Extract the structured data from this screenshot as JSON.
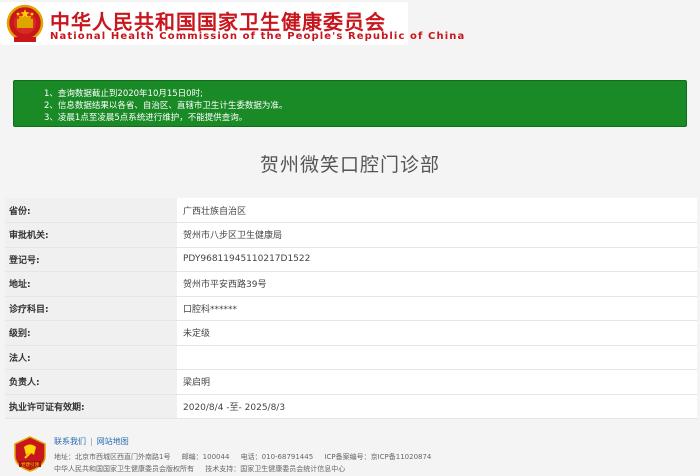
{
  "header": {
    "title_cn": "中华人民共和国国家卫生健康委员会",
    "title_en": "National Health Commission of the People's Republic of China",
    "brand_color": "#c8161d"
  },
  "notice": {
    "background": "#198a26",
    "lines": [
      "1、查询数据截止到2020年10月15日0时;",
      "2、信息数据结果以各省、自治区、直辖市卫生计生委数据为准。",
      "3、凌晨1点至凌晨5点系统进行维护，不能提供查询。"
    ]
  },
  "page_title": "贺州微笑口腔门诊部",
  "info_rows": [
    {
      "label": "省份:",
      "value": "广西壮族自治区"
    },
    {
      "label": "审批机关:",
      "value": "贺州市八步区卫生健康局"
    },
    {
      "label": "登记号:",
      "value": "PDY96811945110217D1522"
    },
    {
      "label": "地址:",
      "value": "贺州市平安西路39号"
    },
    {
      "label": "诊疗科目:",
      "value": "口腔科******"
    },
    {
      "label": "级别:",
      "value": "未定级"
    },
    {
      "label": "法人:",
      "value": ""
    },
    {
      "label": "负责人:",
      "value": "梁启明"
    },
    {
      "label": "执业许可证有效期:",
      "value": "2020/8/4 -至- 2025/8/3"
    }
  ],
  "footer": {
    "links": [
      "联系我们",
      "网站地图"
    ],
    "logo_text": "党建引领",
    "address": "地址：北京市西城区西直门外南路1号",
    "postcode": "邮编：100044",
    "phone": "电话：010-68791445",
    "icp": "ICP备案编号：京ICP备11020874",
    "copyright": "中华人民共和国国家卫生健康委员会版权所有",
    "support": "技术支持：国家卫生健康委员会统计信息中心"
  }
}
